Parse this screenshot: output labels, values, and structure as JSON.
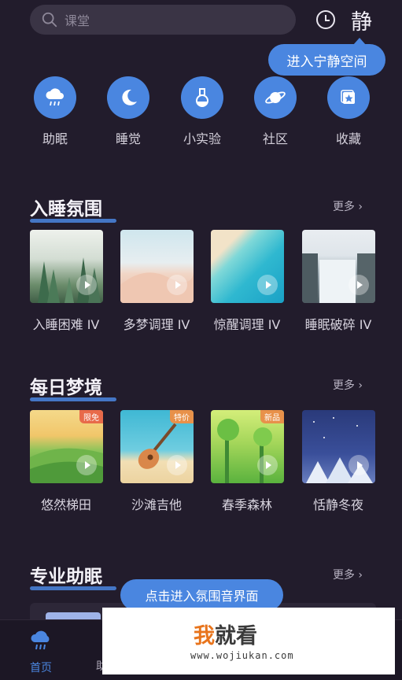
{
  "search": {
    "placeholder": "课堂"
  },
  "header": {
    "quiet_label": "静"
  },
  "tooltip_top": "进入宁静空间",
  "categories": [
    {
      "label": "助眠",
      "icon": "cloud-rain-icon"
    },
    {
      "label": "睡觉",
      "icon": "moon-icon"
    },
    {
      "label": "小实验",
      "icon": "flask-icon"
    },
    {
      "label": "社区",
      "icon": "planet-icon"
    },
    {
      "label": "收藏",
      "icon": "star-bookmark-icon"
    }
  ],
  "sections": [
    {
      "title": "入睡氛围",
      "more": "更多 ›",
      "items": [
        {
          "name": "入睡困难 IV"
        },
        {
          "name": "多梦调理 IV"
        },
        {
          "name": "惊醒调理 IV"
        },
        {
          "name": "睡眠破碎 IV"
        }
      ]
    },
    {
      "title": "每日梦境",
      "more": "更多 ›",
      "items": [
        {
          "name": "悠然梯田",
          "badge": "限免"
        },
        {
          "name": "沙滩吉他",
          "badge": "特价"
        },
        {
          "name": "春季森林",
          "badge": "新品"
        },
        {
          "name": "恬静冬夜"
        }
      ]
    },
    {
      "title": "专业助眠",
      "more": "更多 ›"
    }
  ],
  "tooltip_bottom": "点击进入氛围音界面",
  "tabbar": {
    "home": "首页",
    "second_partial": "助"
  },
  "watermark": {
    "wo": "我",
    "rest": "就看",
    "url": "www.wojiukan.com"
  },
  "colors": {
    "accent": "#4a86e0",
    "background": "#221c2c"
  }
}
